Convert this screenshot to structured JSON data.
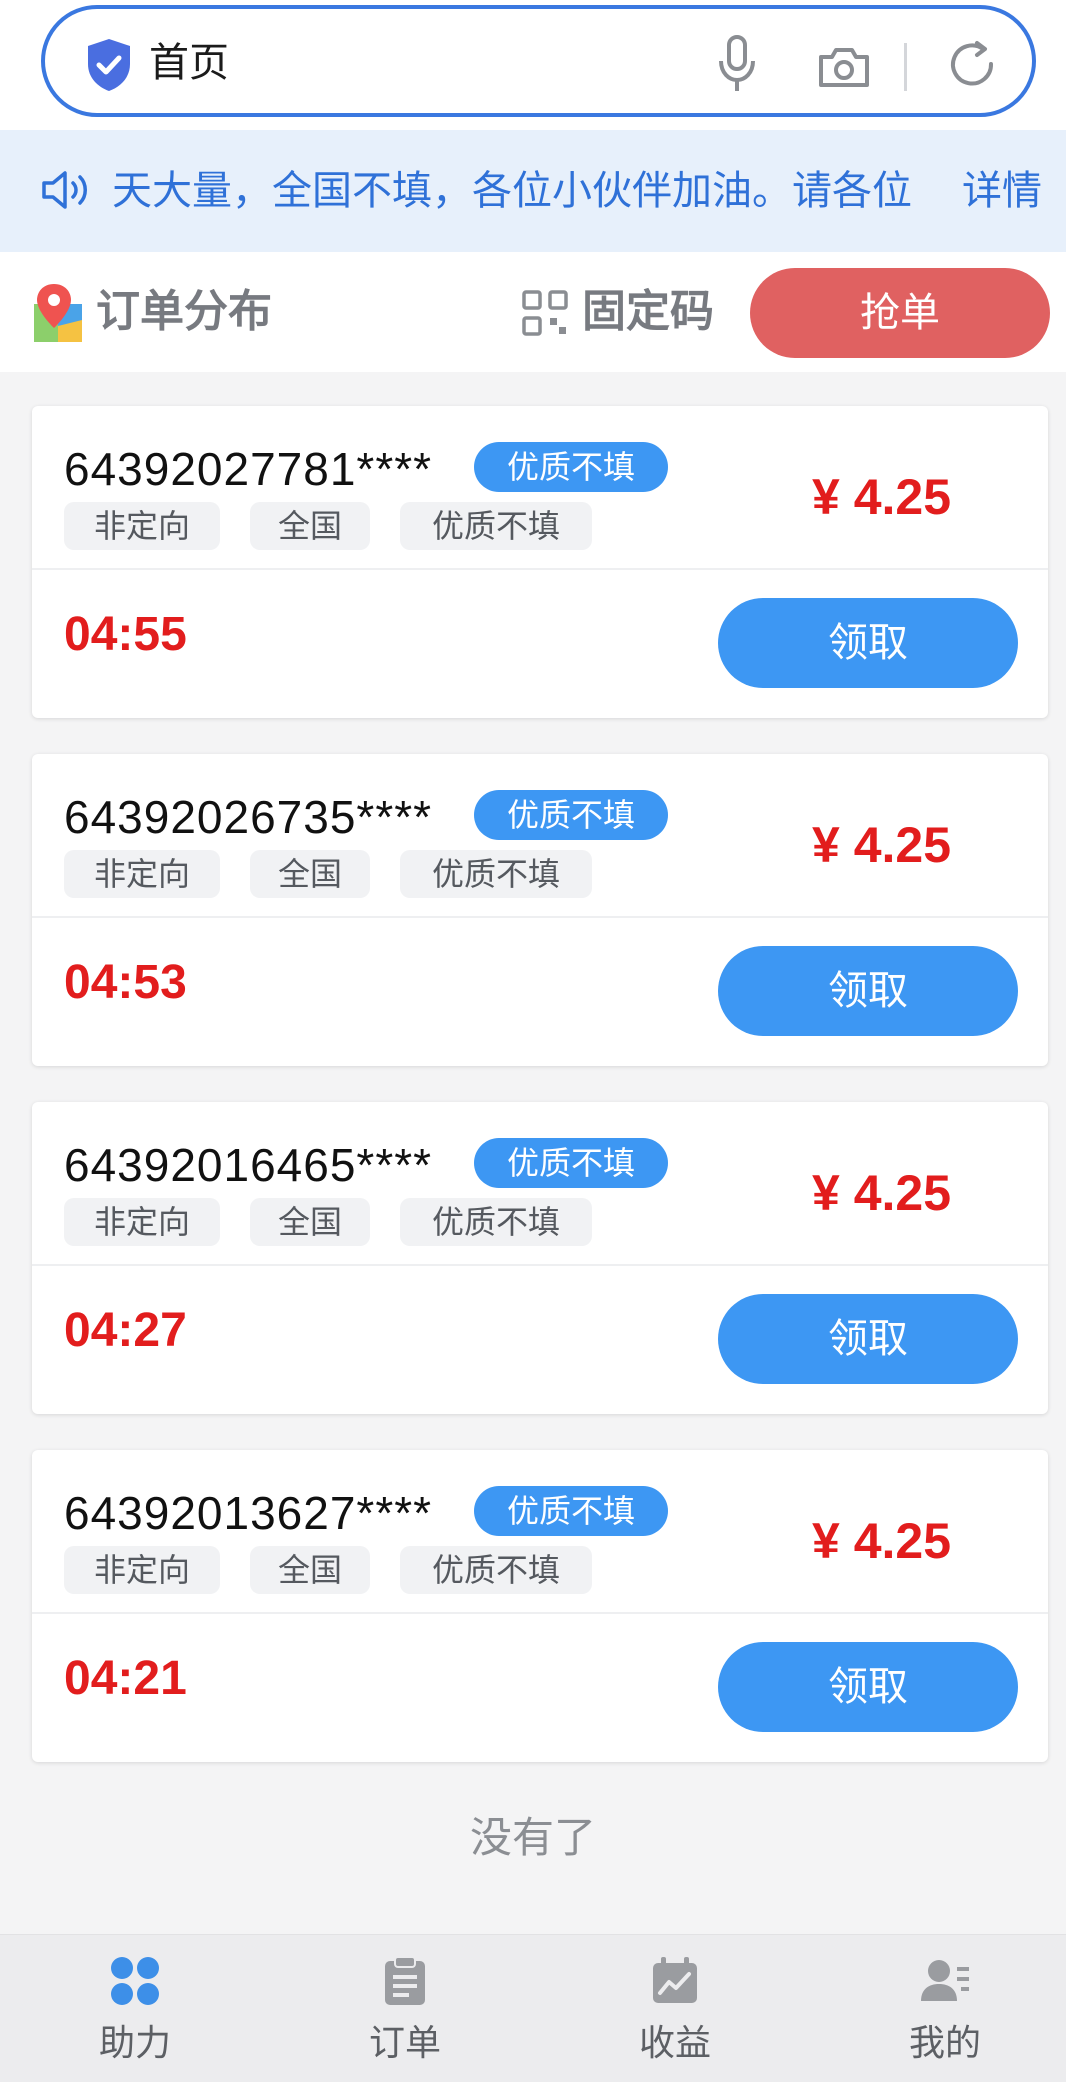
{
  "search": {
    "text": "首页"
  },
  "notice": {
    "text": "天大量，全国不填，各位小伙伴加油。请各位",
    "detail_label": "详情"
  },
  "toolbar": {
    "order_distribution_label": "订单分布",
    "fixed_code_label": "固定码",
    "grab_order_label": "抢单"
  },
  "orders": [
    {
      "number": "64392027781****",
      "badge": "优质不填",
      "tags": [
        "非定向",
        "全国",
        "优质不填"
      ],
      "price": "¥ 4.25",
      "timer": "04:55",
      "claim_label": "领取"
    },
    {
      "number": "64392026735****",
      "badge": "优质不填",
      "tags": [
        "非定向",
        "全国",
        "优质不填"
      ],
      "price": "¥ 4.25",
      "timer": "04:53",
      "claim_label": "领取"
    },
    {
      "number": "64392016465****",
      "badge": "优质不填",
      "tags": [
        "非定向",
        "全国",
        "优质不填"
      ],
      "price": "¥ 4.25",
      "timer": "04:27",
      "claim_label": "领取"
    },
    {
      "number": "64392013627****",
      "badge": "优质不填",
      "tags": [
        "非定向",
        "全国",
        "优质不填"
      ],
      "price": "¥ 4.25",
      "timer": "04:21",
      "claim_label": "领取"
    }
  ],
  "list_end_text": "没有了",
  "bottom_nav": [
    {
      "label": "助力",
      "icon": "grid-icon",
      "active": true
    },
    {
      "label": "订单",
      "icon": "clipboard-icon",
      "active": false
    },
    {
      "label": "收益",
      "icon": "earnings-icon",
      "active": false
    },
    {
      "label": "我的",
      "icon": "profile-icon",
      "active": false
    }
  ],
  "colors": {
    "accent_blue": "#3d97f3",
    "price_red": "#e21d1d",
    "grab_button_red": "#e06161"
  }
}
